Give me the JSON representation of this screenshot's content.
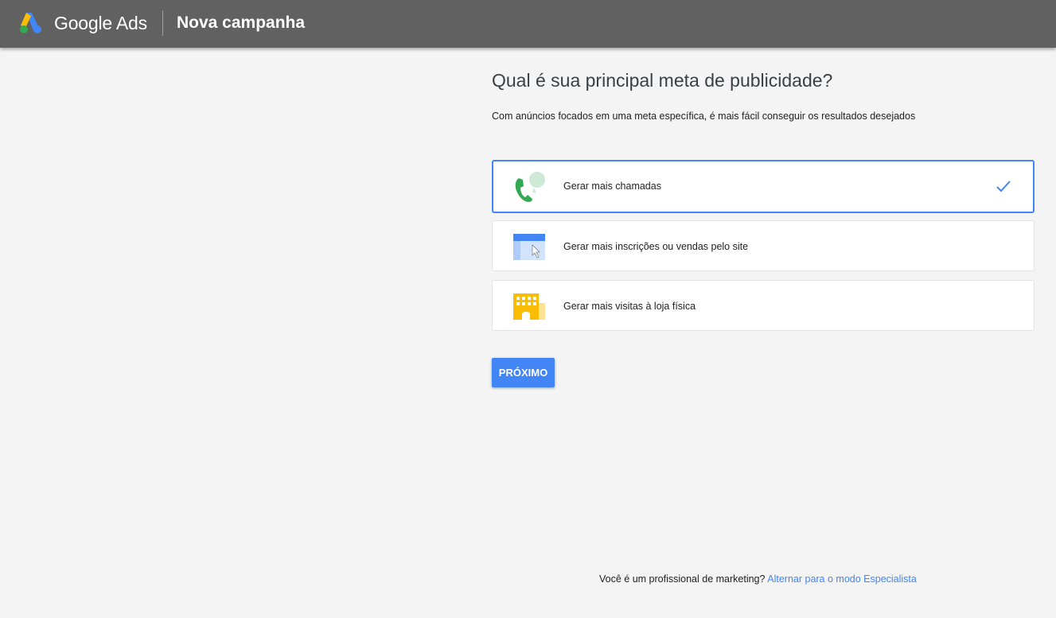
{
  "header": {
    "brand": "Google Ads",
    "title": "Nova campanha",
    "logo_icon": "google-ads-logo"
  },
  "main": {
    "question": "Qual é sua principal meta de publicidade?",
    "subtitle": "Com anúncios focados em uma meta específica, é mais fácil conseguir os resultados desejados",
    "options": [
      {
        "label": "Gerar mais chamadas",
        "icon": "phone-chat-icon",
        "selected": true
      },
      {
        "label": "Gerar mais inscrições ou vendas pelo site",
        "icon": "browser-cursor-icon",
        "selected": false
      },
      {
        "label": "Gerar mais visitas à loja física",
        "icon": "store-building-icon",
        "selected": false
      }
    ],
    "next_label": "PRÓXIMO"
  },
  "footer": {
    "text": "Você é um profissional de marketing?",
    "link": "Alternar para o modo Especialista"
  },
  "colors": {
    "topbar": "#616161",
    "accent": "#4285f4",
    "background": "#f4f4f4"
  }
}
